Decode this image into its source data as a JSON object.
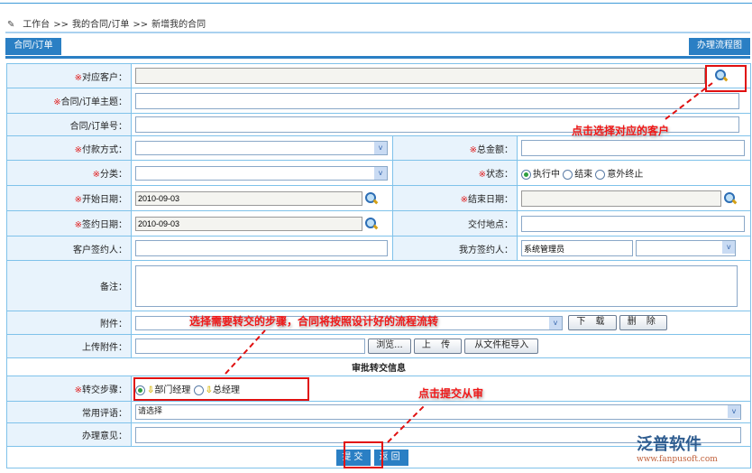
{
  "breadcrumb": {
    "items": [
      "工作台",
      "我的合同/订单",
      "新增我的合同"
    ],
    "sep": ">>"
  },
  "tabs": {
    "active": "合同/订单",
    "flow_button": "办理流程图"
  },
  "fields": {
    "customer": {
      "label": "对应客户：",
      "required": true,
      "value": ""
    },
    "subject": {
      "label": "合同/订单主题：",
      "required": true,
      "value": ""
    },
    "number": {
      "label": "合同/订单号：",
      "value": ""
    },
    "payment": {
      "label": "付款方式：",
      "required": true,
      "value": ""
    },
    "total": {
      "label": "总金额：",
      "required": true,
      "value": ""
    },
    "category": {
      "label": "分类：",
      "required": true,
      "value": ""
    },
    "status": {
      "label": "状态：",
      "required": true,
      "options": [
        "执行中",
        "结束",
        "意外终止"
      ],
      "selected": "执行中"
    },
    "start_date": {
      "label": "开始日期：",
      "required": true,
      "value": "2010-09-03"
    },
    "end_date": {
      "label": "结束日期：",
      "required": true,
      "value": ""
    },
    "sign_date": {
      "label": "签约日期：",
      "required": true,
      "value": "2010-09-03"
    },
    "delivery": {
      "label": "交付地点：",
      "value": ""
    },
    "client_signer": {
      "label": "客户签约人：",
      "value": ""
    },
    "our_signer": {
      "label": "我方签约人：",
      "value": "系统管理员",
      "select": ""
    },
    "remark": {
      "label": "备注：",
      "value": ""
    },
    "attachment": {
      "label": "附件：",
      "download": "下 载",
      "delete": "删 除"
    },
    "upload": {
      "label": "上传附件：",
      "browse": "浏览...",
      "upload": "上 传",
      "import": "从文件柜导入"
    },
    "section_title": "审批转交信息",
    "step": {
      "label": "转交步骤：",
      "required": true,
      "options": [
        "部门经理",
        "总经理"
      ],
      "selected": "部门经理"
    },
    "comment": {
      "label": "常用评语：",
      "value": "请选择"
    },
    "opinion": {
      "label": "办理意见：",
      "value": ""
    }
  },
  "required_mark": "※",
  "buttons": {
    "submit": "提交",
    "back": "返回"
  },
  "annotations": {
    "customer": "点击选择对应的客户",
    "step": "选择需要转交的步骤，合同将按照设计好的流程流转",
    "submit": "点击提交从审"
  },
  "logo": {
    "name": "泛普软件",
    "url": "www.fanpusoft.com"
  }
}
